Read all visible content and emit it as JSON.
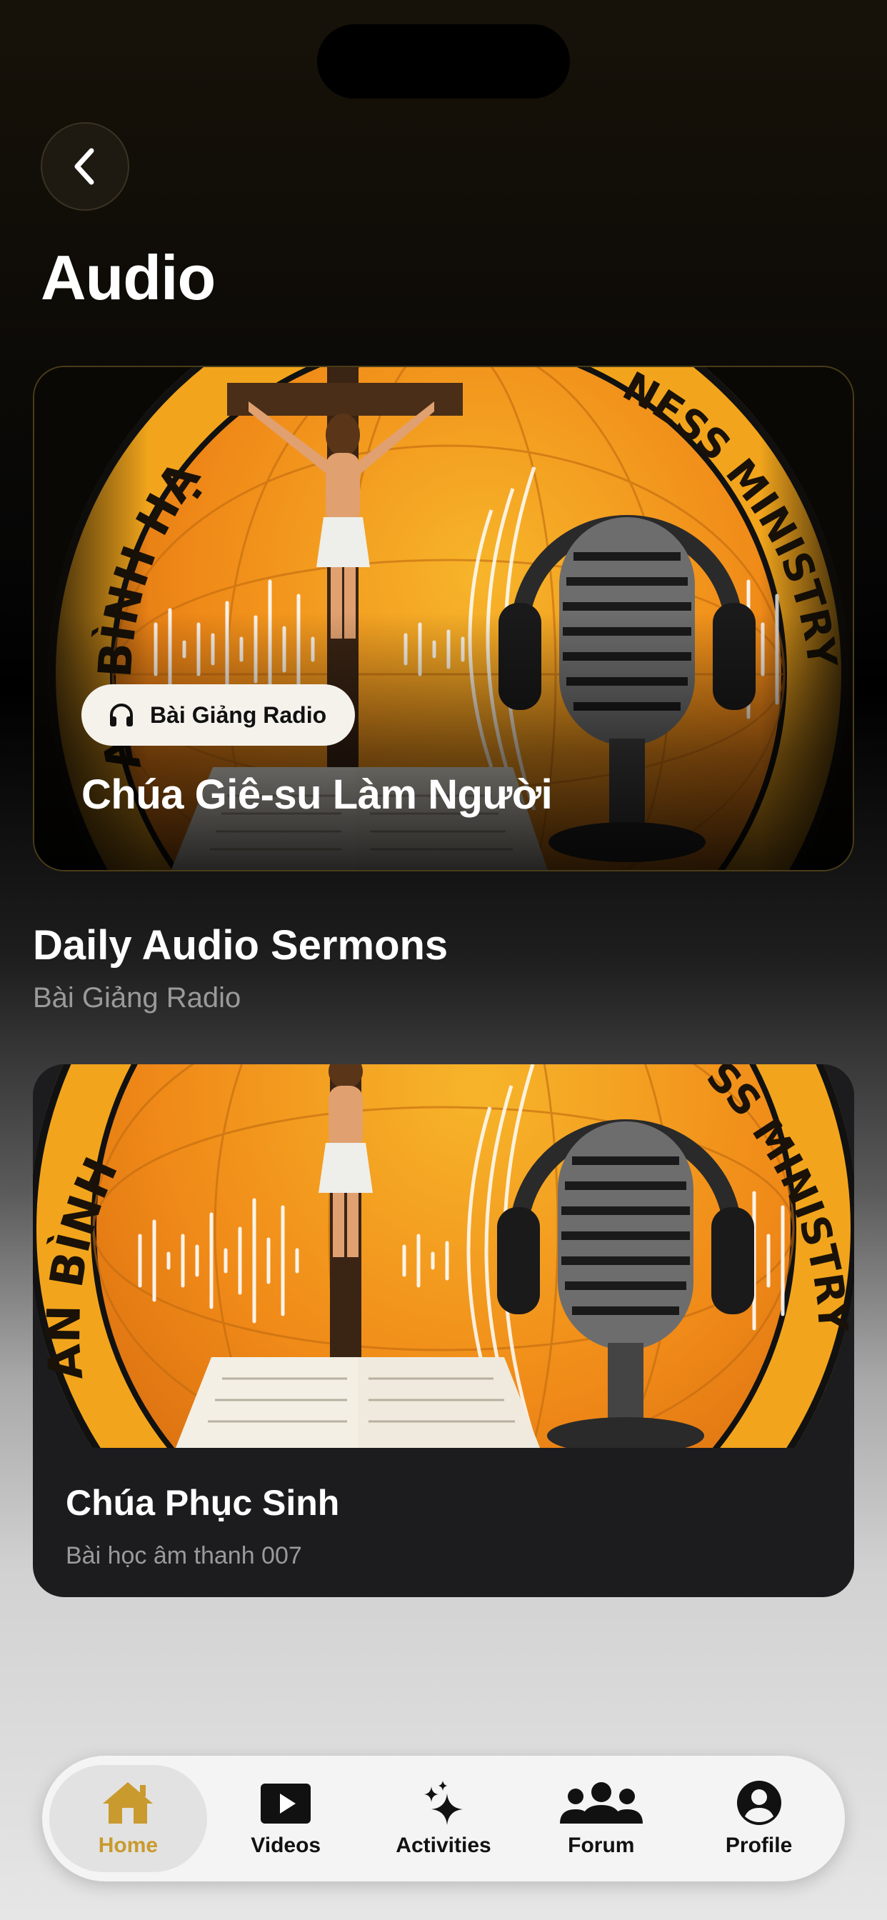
{
  "header": {
    "title": "Audio"
  },
  "hero": {
    "chip_label": "Bài Giảng Radio",
    "chip_icon": "headphones-icon",
    "title": "Chúa Giê-su Làm Người",
    "art_text_left": "AN BÌNH HẠ",
    "art_text_right": "NESS MINISTRY"
  },
  "section": {
    "title": "Daily Audio Sermons",
    "subtitle": "Bài Giảng Radio"
  },
  "card": {
    "title": "Chúa Phục Sinh",
    "subtitle": "Bài học âm thanh 007",
    "art_text_left": "AN BÌNH",
    "art_text_right": "SS MINISTRY"
  },
  "tabs": [
    {
      "label": "Home",
      "icon": "home-icon",
      "active": true
    },
    {
      "label": "Videos",
      "icon": "play-icon",
      "active": false
    },
    {
      "label": "Activities",
      "icon": "sparkles-icon",
      "active": false
    },
    {
      "label": "Forum",
      "icon": "group-icon",
      "active": false
    },
    {
      "label": "Profile",
      "icon": "profile-icon",
      "active": false
    }
  ],
  "colors": {
    "accent": "#c99a2e",
    "art_orange": "#f39a1c",
    "card_bg": "#1c1c1e"
  }
}
